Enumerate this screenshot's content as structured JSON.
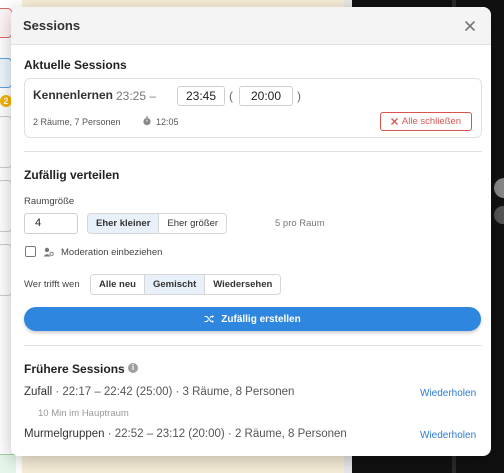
{
  "dialog": {
    "title": "Sessions",
    "close_icon": "close-icon"
  },
  "current_sessions": {
    "title": "Aktuelle Sessions",
    "session": {
      "name": "Kennenlernen",
      "start": "23:25 –",
      "end_value": "23:45",
      "paren_open": "(",
      "duration_value": "20:00",
      "paren_close": ")",
      "meta": "2 Räume, 7 Personen",
      "timer": "12:05",
      "close_all_label": "Alle schließen"
    }
  },
  "random_distribute": {
    "title": "Zufällig verteilen",
    "room_size_label": "Raumgröße",
    "room_size_value": "4",
    "size_options": [
      "Eher kleiner",
      "Eher größer"
    ],
    "size_selected": "Eher kleiner",
    "per_room": "5 pro Raum",
    "moderation_label": "Moderation einbeziehen",
    "moderation_checked": false,
    "who_meets_label": "Wer trifft wen",
    "meet_options": [
      "Alle neu",
      "Gemischt",
      "Wiedersehen"
    ],
    "meet_selected": "Gemischt",
    "create_button": "Zufällig erstellen",
    "accent_color": "#2f86de"
  },
  "history": {
    "title": "Frühere Sessions",
    "items": [
      {
        "name": "Zufall",
        "details": " · 22:17 – 22:42 (25:00) · 3 Räume, 8 Personen",
        "sub": "10 Min im Hauptraum",
        "action": "Wiederholen"
      },
      {
        "name": "Murmelgruppen",
        "details": " · 22:52 – 23:12 (20:00) · 2 Räume, 8 Personen",
        "action": "Wiederholen"
      }
    ]
  },
  "background": {
    "badge": "2"
  }
}
